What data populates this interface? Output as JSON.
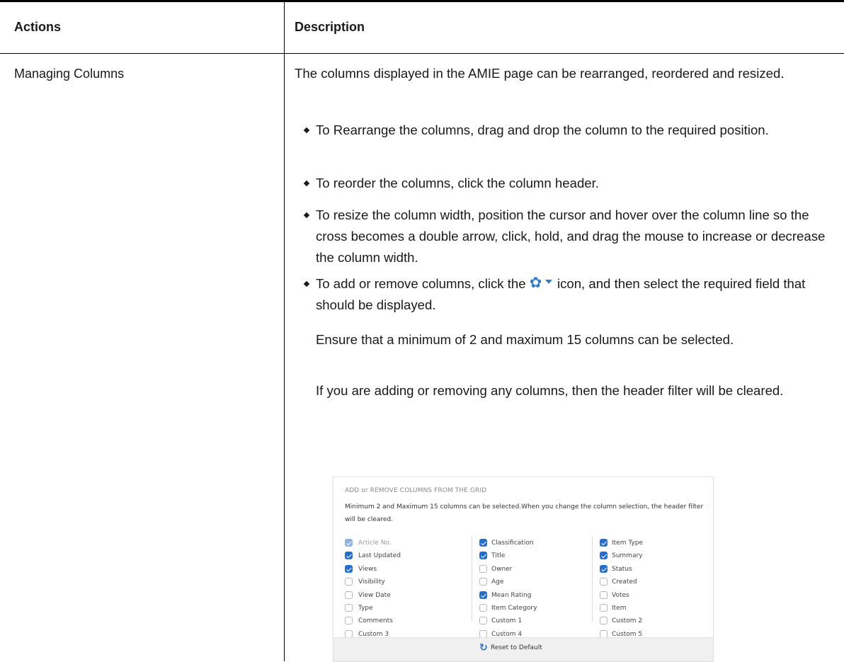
{
  "table": {
    "headers": {
      "actions": "Actions",
      "description": "Description"
    },
    "row": {
      "action": "Managing Columns",
      "intro": "The columns displayed in the AMIE page can be rearranged, reordered and resized.",
      "bullets": [
        "To Rearrange the columns, drag and drop the column to the required position.",
        "To reorder the columns, click the column header.",
        "To resize the column width, position the cursor and hover over the column line so the cross becomes a double arrow, click, hold, and drag the mouse to increase or decrease the column width."
      ],
      "add_remove": {
        "before_icon": "To add or remove columns, click the",
        "icon": "gear-dropdown-icon",
        "after_icon": "icon, and then select the required field that should be displayed."
      },
      "note1": "Ensure that a minimum of 2 and maximum 15 columns can be selected.",
      "note2": "If you are adding or removing any columns, then the header filter will be cleared."
    }
  },
  "panel": {
    "title": "ADD or REMOVE COLUMNS FROM THE GRID",
    "description": "Minimum 2 and Maximum 15 columns can be selected.When you change the column selection, the header filter will be cleared.",
    "columns": [
      [
        {
          "label": "Article No.",
          "checked": true,
          "disabled": true
        },
        {
          "label": "Last Updated",
          "checked": true
        },
        {
          "label": "Views",
          "checked": true
        },
        {
          "label": "Visibility",
          "checked": false
        },
        {
          "label": "View Date",
          "checked": false
        },
        {
          "label": "Type",
          "checked": false
        },
        {
          "label": "Comments",
          "checked": false
        },
        {
          "label": "Custom 3",
          "checked": false
        }
      ],
      [
        {
          "label": "Classification",
          "checked": true
        },
        {
          "label": "Title",
          "checked": true
        },
        {
          "label": "Owner",
          "checked": false
        },
        {
          "label": "Age",
          "checked": false
        },
        {
          "label": "Mean Rating",
          "checked": true
        },
        {
          "label": "Item Category",
          "checked": false
        },
        {
          "label": "Custom 1",
          "checked": false
        },
        {
          "label": "Custom 4",
          "checked": false
        }
      ],
      [
        {
          "label": "Item Type",
          "checked": true
        },
        {
          "label": "Summary",
          "checked": true
        },
        {
          "label": "Status",
          "checked": true
        },
        {
          "label": "Created",
          "checked": false
        },
        {
          "label": "Votes",
          "checked": false
        },
        {
          "label": "Item",
          "checked": false
        },
        {
          "label": "Custom 2",
          "checked": false
        },
        {
          "label": "Custom 5",
          "checked": false
        }
      ]
    ],
    "reset_label": "Reset to Default"
  },
  "colors": {
    "accent": "#1f6fd6",
    "gear": "#2a7fd4",
    "rule": "#000000"
  }
}
